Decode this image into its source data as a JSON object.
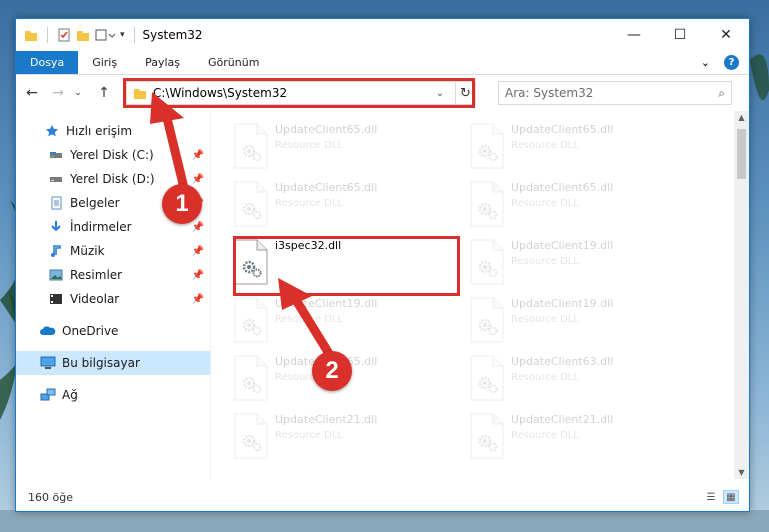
{
  "window": {
    "title": "System32",
    "controls": {
      "minimize": "—",
      "maximize": "☐",
      "close": "✕"
    }
  },
  "ribbon": {
    "tabs": [
      {
        "label": "Dosya",
        "active": true
      },
      {
        "label": "Giriş",
        "active": false
      },
      {
        "label": "Paylaş",
        "active": false
      },
      {
        "label": "Görünüm",
        "active": false
      }
    ],
    "expand": "⌄",
    "help": "?"
  },
  "address": {
    "path": "C:\\Windows\\System32",
    "search_placeholder": "Ara: System32"
  },
  "nav": {
    "quick_access": "Hızlı erişim",
    "pinned": [
      {
        "label": "Yerel Disk (C:)",
        "icon": "drive-icon"
      },
      {
        "label": "Yerel Disk (D:)",
        "icon": "drive-icon"
      },
      {
        "label": "Belgeler",
        "icon": "documents-icon"
      },
      {
        "label": "İndirmeler",
        "icon": "downloads-icon"
      },
      {
        "label": "Müzik",
        "icon": "music-icon"
      },
      {
        "label": "Resimler",
        "icon": "pictures-icon"
      },
      {
        "label": "Videolar",
        "icon": "videos-icon"
      }
    ],
    "onedrive": "OneDrive",
    "this_pc": "Bu bilgisayar",
    "network": "Ağ"
  },
  "files": {
    "col1": [
      {
        "name": "UpdateClient65.dll",
        "type": "Resource DLL",
        "faded": true
      },
      {
        "name": "UpdateClient65.dll",
        "type": "Resource DLL",
        "faded": true
      },
      {
        "name": "i3spec32.dll",
        "type": "",
        "faded": false
      },
      {
        "name": "UpdateClient19.dll",
        "type": "Resource DLL",
        "faded": true
      },
      {
        "name": "UpdateClient65.dll",
        "type": "Resource DLL",
        "faded": true
      },
      {
        "name": "UpdateClient21.dll",
        "type": "Resource DLL",
        "faded": true
      }
    ],
    "col2": [
      {
        "name": "UpdateClient65.dll",
        "type": "Resource DLL",
        "faded": true
      },
      {
        "name": "UpdateClient65.dll",
        "type": "Resource DLL",
        "faded": true
      },
      {
        "name": "UpdateClient19.dll",
        "type": "Resource DLL",
        "faded": true
      },
      {
        "name": "UpdateClient19.dll",
        "type": "Resource DLL",
        "faded": true
      },
      {
        "name": "UpdateClient63.dll",
        "type": "Resource DLL",
        "faded": true
      },
      {
        "name": "UpdateClient21.dll",
        "type": "Resource DLL",
        "faded": true
      }
    ]
  },
  "status": {
    "count": "160 öğe"
  },
  "annotations": {
    "step1": "1",
    "step2": "2",
    "color": "#d9302a"
  }
}
